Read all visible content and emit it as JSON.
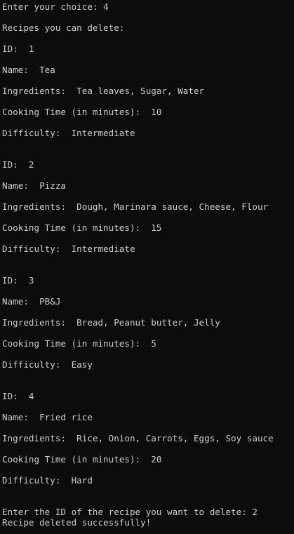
{
  "terminal": {
    "lines": [
      "Enter your choice: 4",
      "Recipes you can delete:",
      "ID:  1",
      "Name:  Tea",
      "Ingredients:  Tea leaves, Sugar, Water",
      "Cooking Time (in minutes):  10",
      "Difficulty:  Intermediate",
      "ID:  2",
      "Name:  Pizza",
      "Ingredients:  Dough, Marinara sauce, Cheese, Flour",
      "Cooking Time (in minutes):  15",
      "Difficulty:  Intermediate",
      "ID:  3",
      "Name:  PB&J",
      "Ingredients:  Bread, Peanut butter, Jelly",
      "Cooking Time (in minutes):  5",
      "Difficulty:  Easy",
      "ID:  4",
      "Name:  Fried rice",
      "Ingredients:  Rice, Onion, Carrots, Eggs, Soy sauce",
      "Cooking Time (in minutes):  20",
      "Difficulty:  Hard",
      "Enter the ID of the recipe you want to delete: 2",
      "Recipe deleted successfully!"
    ]
  }
}
